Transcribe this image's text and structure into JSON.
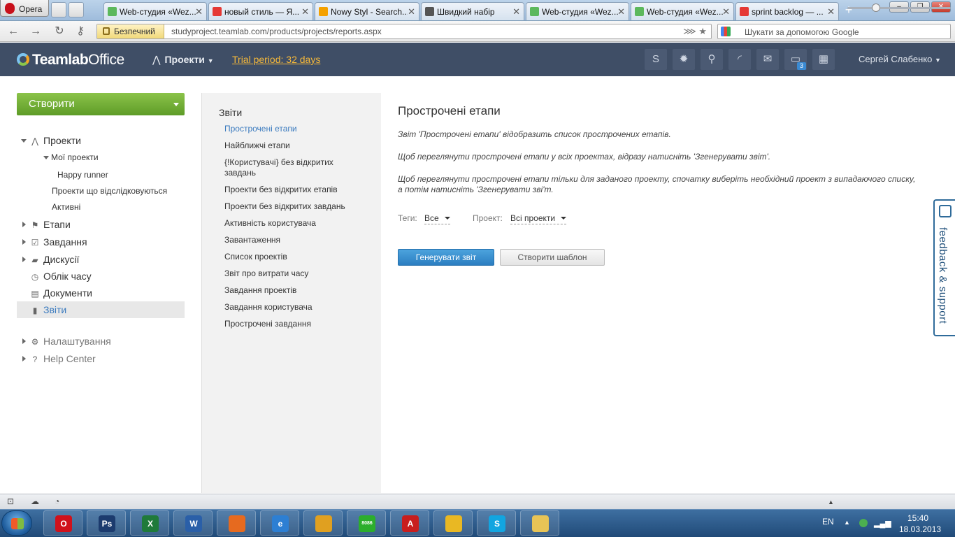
{
  "browser": {
    "menu_label": "Opera",
    "tabs": [
      {
        "title": "Web-студия «Wez...",
        "icon_color": "#5cb85c"
      },
      {
        "title": "новый стиль — Я...",
        "icon_color": "#e53935"
      },
      {
        "title": "Nowy Styl - Search...",
        "icon_color": "#f4a100"
      },
      {
        "title": "Швидкий набір",
        "icon_color": "#555555"
      },
      {
        "title": "Web-студия «Wez...",
        "icon_color": "#5cb85c"
      },
      {
        "title": "Web-студия «Wez...",
        "icon_color": "#5cb85c"
      },
      {
        "title": "sprint backlog — ...",
        "icon_color": "#e53935"
      }
    ],
    "security_label": "Безпечний",
    "url": "studyproject.teamlab.com/products/projects/reports.aspx",
    "search_placeholder": "Шукати за допомогою Google"
  },
  "header": {
    "logo_text_bold": "Teamlab",
    "logo_text": "Office",
    "module_menu": "Проекти",
    "trial_text": "Trial period: 32 days",
    "icons": [
      "skype-icon",
      "gear-icon",
      "search-icon",
      "feed-icon",
      "mail-icon",
      "chat-icon",
      "calendar-icon"
    ],
    "chat_badge": "3",
    "user_name": "Сергей Слабенко"
  },
  "sidebar": {
    "create_label": "Створити",
    "projects_label": "Проекти",
    "my_projects_label": "Мої проекти",
    "project_item": "Happy runner",
    "followed_label": "Проекти що відслідковуються",
    "active_label": "Активні",
    "items": [
      {
        "label": "Етапи",
        "icon": "flag-icon"
      },
      {
        "label": "Завдання",
        "icon": "checkbox-icon"
      },
      {
        "label": "Дискусії",
        "icon": "discussion-icon"
      },
      {
        "label": "Облік часу",
        "icon": "clock-icon"
      },
      {
        "label": "Документи",
        "icon": "document-icon"
      },
      {
        "label": "Звіти",
        "icon": "chart-icon"
      }
    ],
    "settings_label": "Налаштування",
    "help_label": "Help Center"
  },
  "reports": {
    "title": "Звіти",
    "links": [
      "Прострочені етапи",
      "Найближчі етапи",
      "{!Користувачі} без відкритих завдань",
      "Проекти без відкритих етапів",
      "Проекти без відкритих завдань",
      "Активність користувача",
      "Завантаження",
      "Список проектів",
      "Звіт про витрати часу",
      "Завдання проектів",
      "Завдання користувача",
      "Прострочені завдання"
    ]
  },
  "main": {
    "title": "Прострочені етапи",
    "desc1": "Звіт 'Прострочені етапи' відобразить список прострочених етапів.",
    "desc2": "Щоб переглянути прострочені етапи у всіх проектах, відразу натисніть 'Згенерувати звіт'.",
    "desc3a": "Щоб переглянути прострочені етапи тільки для заданого проекту, спочатку виберіть необхідний проект з випадаючого списку,",
    "desc3b": "а потім натисніть 'Згенерувати зві'т.",
    "tags_label": "Теги:",
    "tags_value": "Все",
    "project_label": "Проект:",
    "project_value": "Всі проекти",
    "generate_button": "Генерувати звіт",
    "template_button": "Створити шаблон"
  },
  "feedback": {
    "label": "feedback & support"
  },
  "taskbar": {
    "apps": [
      {
        "name": "opera-icon",
        "label": "O",
        "color": "#d0111b"
      },
      {
        "name": "photoshop-icon",
        "label": "Ps",
        "color": "#1c3b6e"
      },
      {
        "name": "excel-icon",
        "label": "X",
        "color": "#1f7a3a"
      },
      {
        "name": "word-icon",
        "label": "W",
        "color": "#2a5fa8"
      },
      {
        "name": "firefox-icon",
        "label": "",
        "color": "#e66a1f"
      },
      {
        "name": "ie-icon",
        "label": "e",
        "color": "#2d7fd3"
      },
      {
        "name": "winamp-icon",
        "label": "",
        "color": "#e0a020"
      },
      {
        "name": "emulator-icon",
        "label": "8086",
        "color": "#2cae2c"
      },
      {
        "name": "acrobat-icon",
        "label": "A",
        "color": "#c81e1e"
      },
      {
        "name": "chrome-icon",
        "label": "",
        "color": "#e9b823"
      },
      {
        "name": "skype-icon",
        "label": "S",
        "color": "#12a5e0"
      },
      {
        "name": "explorer-icon",
        "label": "",
        "color": "#e8c456"
      }
    ],
    "lang": "EN",
    "time": "15:40",
    "date": "18.03.2013"
  }
}
